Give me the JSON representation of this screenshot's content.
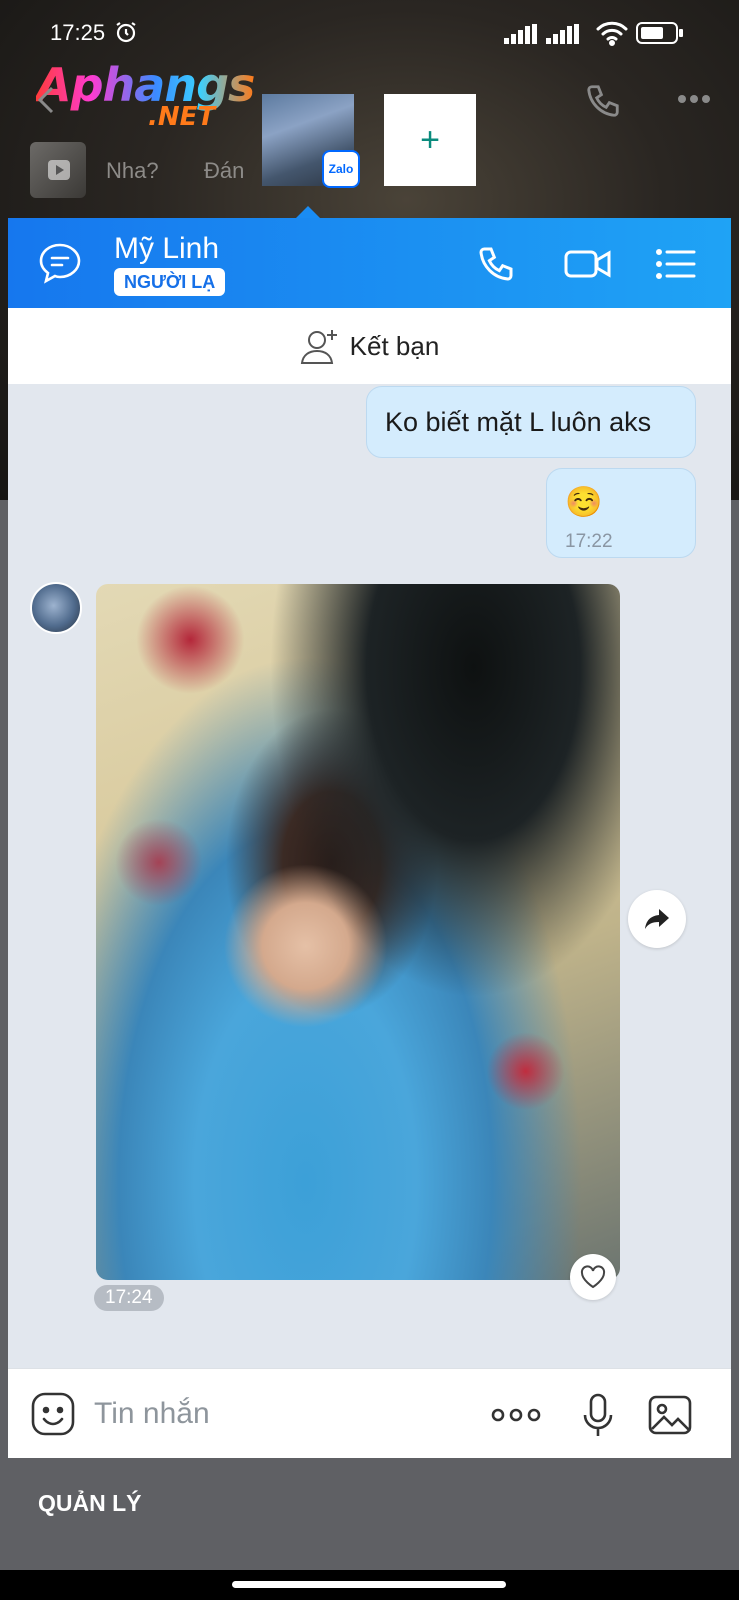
{
  "status_bar": {
    "time": "17:25"
  },
  "watermark": {
    "main": "Aphangs",
    "sub": ".NET"
  },
  "background": {
    "preview_texts": [
      "Nha?",
      "Đán"
    ],
    "app_badge": "Zalo",
    "add_label": "+"
  },
  "chat": {
    "contact_name": "Mỹ Linh",
    "contact_badge": "NGƯỜI LẠ",
    "add_friend_label": "Kết bạn",
    "messages": [
      {
        "direction": "out",
        "text": "Ko biết mặt L luôn aks"
      },
      {
        "direction": "out",
        "text": "☺️",
        "time": "17:22"
      },
      {
        "direction": "in",
        "type": "photo",
        "time": "17:24"
      }
    ],
    "composer": {
      "placeholder": "Tin nhắn"
    }
  },
  "footer": {
    "manage_label": "QUẢN LÝ"
  },
  "colors": {
    "accent": "#1a8cf3",
    "bubble_out": "#d4ecfd",
    "chat_bg": "#e2e7ee"
  }
}
